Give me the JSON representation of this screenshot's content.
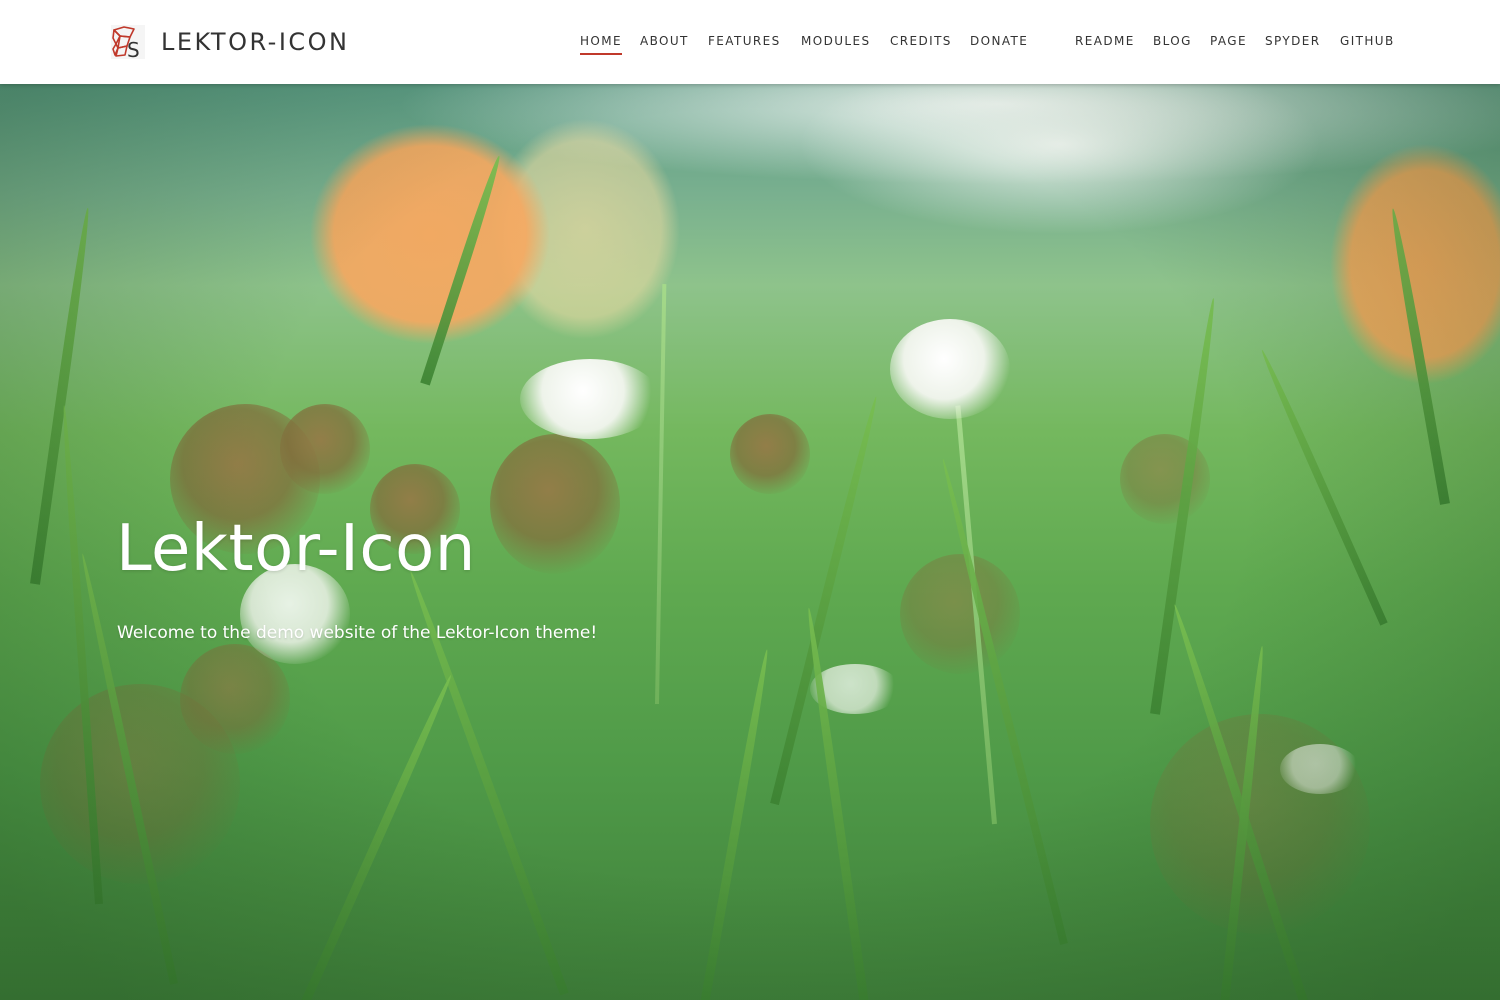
{
  "brand": {
    "name": "LEKTOR-ICON",
    "logo_icon": "lektor-icon-logo",
    "logo_accent_color": "#c0392b"
  },
  "nav": {
    "items": [
      {
        "label": "HOME",
        "active": true
      },
      {
        "label": "ABOUT",
        "active": false
      },
      {
        "label": "FEATURES",
        "active": false
      },
      {
        "label": "MODULES",
        "active": false
      },
      {
        "label": "CREDITS",
        "active": false
      },
      {
        "label": "DONATE",
        "active": false
      },
      {
        "label": "README",
        "active": false
      },
      {
        "label": "BLOG",
        "active": false
      },
      {
        "label": "PAGE",
        "active": false
      },
      {
        "label": "SPYDER",
        "active": false
      },
      {
        "label": "GITHUB",
        "active": false
      }
    ],
    "active_underline_color": "#c0392b"
  },
  "hero": {
    "title": "Lektor-Icon",
    "subtitle": "Welcome to the demo website of the Lektor-Icon theme!"
  }
}
